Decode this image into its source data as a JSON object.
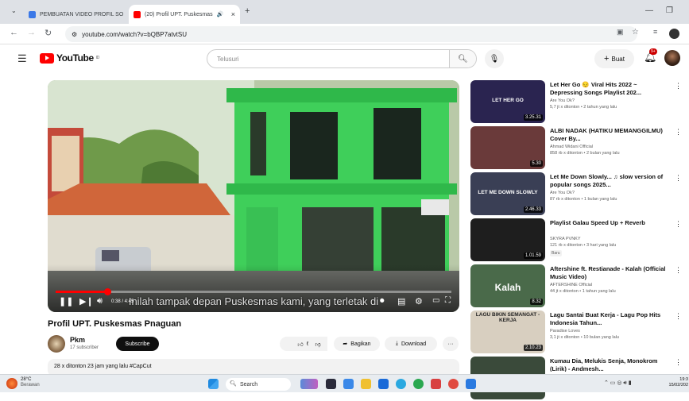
{
  "browser": {
    "tabs": [
      {
        "title": "PEMBUATAN VIDEO PROFIL SO",
        "color": "#3b78e7"
      },
      {
        "title": "(20) Profil UPT. Puskesmas",
        "color": "#ff0000"
      }
    ],
    "url": "youtube.com/watch?v=bQBP7atvtSU",
    "tab_close": "×",
    "new_tab": "+"
  },
  "youtube": {
    "logo_text": "YouTube",
    "logo_sup": "ID",
    "search_placeholder": "Telusuri",
    "create_label": "Buat",
    "notif_count": "9+"
  },
  "player": {
    "subtitle": "Inilah tampak depan Puskesmas kami, yang terletak di",
    "timecode": "0:38 / 4:45",
    "progress": 0.13
  },
  "video": {
    "title": "Profil UPT. Puskesmas Pnaguan",
    "channel": "Pkm",
    "subscribers": "17 subscriber",
    "subscribe_label": "Subscribe",
    "likes": "6",
    "share_label": "Bagikan",
    "download_label": "Download",
    "more": "···",
    "description": "28 x ditonton  23 jam yang lalu  #CapCut"
  },
  "recommendations": [
    {
      "title": "Let Her Go 😔 Viral Hits 2022 ~ Depressing Songs Playlist 202...",
      "channel": "Are You Ok?",
      "meta": "5,7 jt x ditonton • 2 tahun yang lalu",
      "duration": "3.25.31",
      "thumb_text": "LET HER GO",
      "thumb_color": "#2a2450",
      "badge": ""
    },
    {
      "title": "ALBI NADAK (HATIKU MEMANGGILMU) Cover By...",
      "channel": "Ahmad Widani Official",
      "meta": "858 rb x ditonton • 2 bulan yang lalu",
      "duration": "5.30",
      "thumb_text": "",
      "thumb_color": "#6a3a3a",
      "badge": ""
    },
    {
      "title": "Let Me Down Slowly... ♫ slow version of popular songs 2025...",
      "channel": "Are You Ok?",
      "meta": "87 rb x ditonton • 1 bulan yang lalu",
      "duration": "2.46.33",
      "thumb_text": "LET ME DOWN SLOWLY",
      "thumb_color": "#3a3f55",
      "badge": ""
    },
    {
      "title": "Playlist Galau Speed Up + Reverb",
      "channel": "SKYRA PVNKY",
      "meta": "121 rb x ditonton • 3 hari yang lalu",
      "duration": "1.01.59",
      "thumb_text": "",
      "thumb_color": "#1e1e1e",
      "badge": "Baru"
    },
    {
      "title": "Aftershine ft. Restianade - Kalah (Official Music Video)",
      "channel": "AFTERSHINE Official",
      "meta": "44 jt x ditonton • 1 tahun yang lalu",
      "duration": "8.32",
      "thumb_text": "Kalah",
      "thumb_color": "#4a6a4a",
      "badge": ""
    },
    {
      "title": "Lagu Santai Buat Kerja - Lagu Pop Hits Indonesia Tahun...",
      "channel": "Paradise Loves",
      "meta": "3,1 jt x ditonton • 10 bulan yang lalu",
      "duration": "2.10.23",
      "thumb_text": "LAGU BIKIN SEMANGAT - KERJA",
      "thumb_color": "#d8cfc0",
      "badge": ""
    },
    {
      "title": "Kumau Dia, Melukis Senja, Monokrom (Lirik) - Andmesh...",
      "channel": "",
      "meta": "",
      "duration": "",
      "thumb_text": "",
      "thumb_color": "#3a4a3a",
      "badge": ""
    }
  ],
  "taskbar": {
    "weather_temp": "28°C",
    "weather_desc": "Berawan",
    "search_label": "Search",
    "time": "19:3",
    "date": "15/02/202"
  }
}
